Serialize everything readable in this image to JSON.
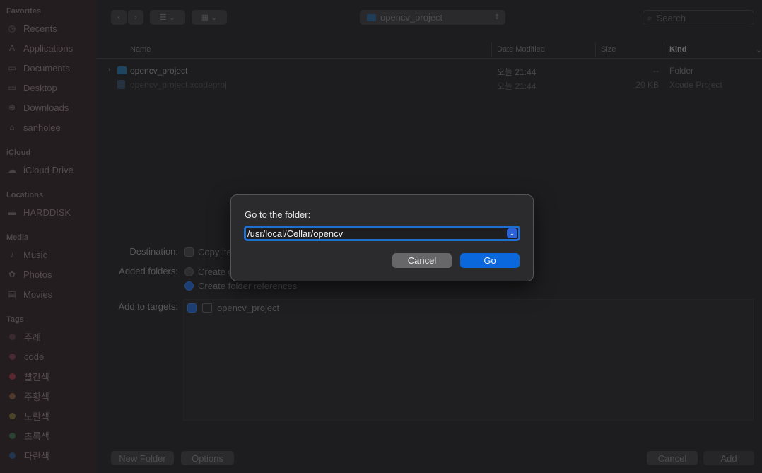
{
  "sidebar": {
    "sections": {
      "favorites": "Favorites",
      "icloud": "iCloud",
      "locations": "Locations",
      "media": "Media",
      "tags": "Tags"
    },
    "favorites": [
      "Recents",
      "Applications",
      "Documents",
      "Desktop",
      "Downloads",
      "sanholee"
    ],
    "icloud": [
      "iCloud Drive"
    ],
    "locations": [
      "HARDDISK"
    ],
    "media": [
      "Music",
      "Photos",
      "Movies"
    ],
    "tags": [
      {
        "label": "주례",
        "color": "#5a2f3a"
      },
      {
        "label": "code",
        "color": "#4a2a34"
      },
      {
        "label": "빨간색",
        "color": "#5a2630"
      },
      {
        "label": "주황색",
        "color": "#4d3a2a"
      },
      {
        "label": "노란색",
        "color": "#4b4328"
      },
      {
        "label": "초록색",
        "color": "#2a4232"
      },
      {
        "label": "파란색",
        "color": "#23364f"
      }
    ]
  },
  "toolbar": {
    "path_label": "opencv_project",
    "search_placeholder": "Search"
  },
  "columns": {
    "name": "Name",
    "date": "Date Modified",
    "size": "Size",
    "kind": "Kind"
  },
  "files": [
    {
      "name": "opencv_project",
      "date": "오늘 21:44",
      "size": "--",
      "kind": "Folder"
    },
    {
      "name": "opencv_project.xcodeproj",
      "date": "오늘 21:44",
      "size": "20 KB",
      "kind": "Xcode Project"
    }
  ],
  "options": {
    "destination_label": "Destination:",
    "destination_value": "Copy items if needed",
    "added_folders_label": "Added folders:",
    "create_groups": "Create groups",
    "create_refs": "Create folder references",
    "targets_label": "Add to targets:",
    "target_name": "opencv_project"
  },
  "bottom": {
    "new_folder": "New Folder",
    "options": "Options",
    "cancel": "Cancel",
    "add": "Add"
  },
  "dialog": {
    "title": "Go to the folder:",
    "path_value": "/usr/local/Cellar/opencv",
    "cancel": "Cancel",
    "go": "Go"
  },
  "colors": {
    "accent": "#0a68dc",
    "focus_ring": "#1f6fd0"
  }
}
